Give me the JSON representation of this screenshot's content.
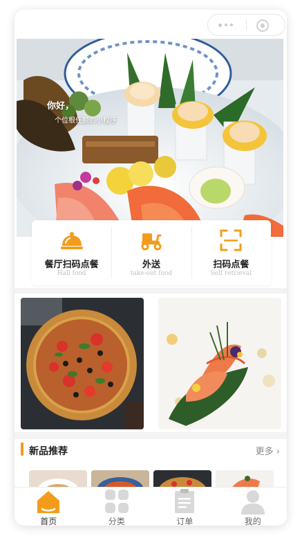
{
  "hero": {
    "greeting": "你好，",
    "subtitle": "个位根任额的小程序"
  },
  "services": [
    {
      "title": "餐厅扫码点餐",
      "subtitle": "Hall food",
      "icon": "cloche-icon"
    },
    {
      "title": "外送",
      "subtitle": "take-out food",
      "icon": "scooter-icon"
    },
    {
      "title": "扫码点餐",
      "subtitle": "Self retrieval",
      "icon": "scan-icon"
    }
  ],
  "new_products": {
    "title": "新品推荐",
    "more": "更多"
  },
  "tabs": [
    {
      "label": "首页",
      "icon": "home-icon",
      "active": true
    },
    {
      "label": "分类",
      "icon": "category-icon",
      "active": false
    },
    {
      "label": "订单",
      "icon": "order-icon",
      "active": false
    },
    {
      "label": "我的",
      "icon": "user-icon",
      "active": false
    }
  ],
  "colors": {
    "accent": "#f39c1b",
    "inactive_icon": "#d8d8d8",
    "divider": "#f3f3f3"
  }
}
